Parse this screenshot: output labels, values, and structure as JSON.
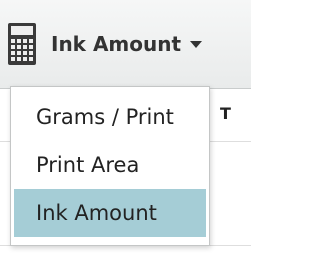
{
  "toolbar": {
    "dropdown_label": "Ink Amount",
    "icon": "calculator-icon",
    "caret_icon": "caret-down-icon"
  },
  "table": {
    "header_cell": "T"
  },
  "menu": {
    "items": [
      {
        "label": "Grams / Print",
        "selected": false
      },
      {
        "label": "Print Area",
        "selected": false
      },
      {
        "label": "Ink Amount",
        "selected": true
      }
    ],
    "selected_color": "#a5cdd6"
  }
}
